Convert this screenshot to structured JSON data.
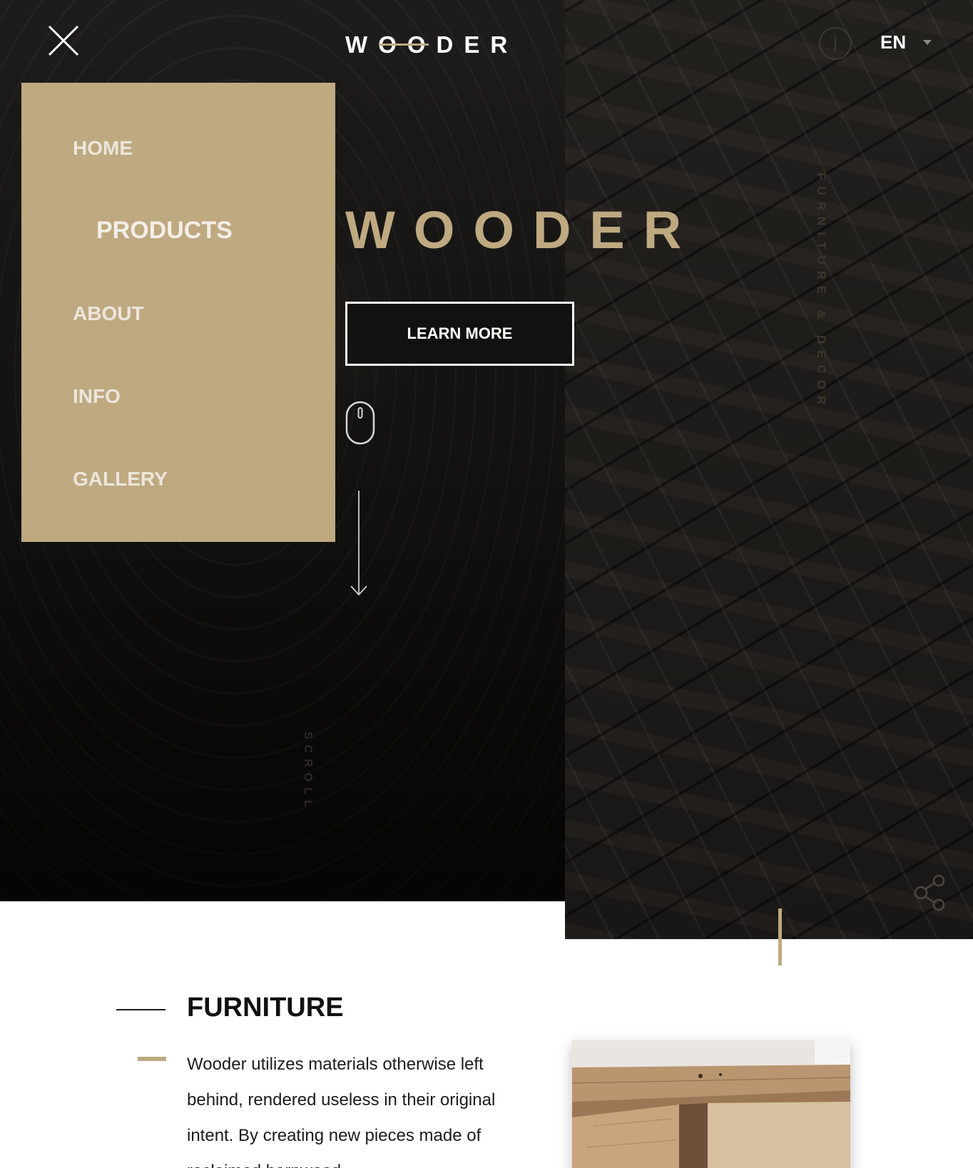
{
  "header": {
    "logo_text": "WOODER",
    "language": "EN",
    "close_icon": "close-icon",
    "info_icon": "info-icon",
    "caret_icon": "chevron-down-icon"
  },
  "menu": {
    "items": [
      {
        "label": "HOME",
        "active": false
      },
      {
        "label": "PRODUCTS",
        "active": true
      },
      {
        "label": "ABOUT",
        "active": false
      },
      {
        "label": "INFO",
        "active": false
      },
      {
        "label": "GALLERY",
        "active": false
      }
    ]
  },
  "hero": {
    "title": "WOODER",
    "cta_label": "LEARN MORE",
    "scroll_label": "SCROLL",
    "tagline": "FURNITURE & DECOR",
    "mouse_icon": "mouse-icon",
    "arrow_icon": "arrow-down-icon",
    "share_icon": "share-icon"
  },
  "furniture": {
    "title": "FURNITURE",
    "body": "Wooder utilizes materials otherwise left behind, rendered useless in their original intent. By creating new pieces made of reclaimed barnwood"
  },
  "colors": {
    "accent_gold": "#bfa981",
    "dark_bg": "#141311",
    "text_dark": "#111111"
  }
}
